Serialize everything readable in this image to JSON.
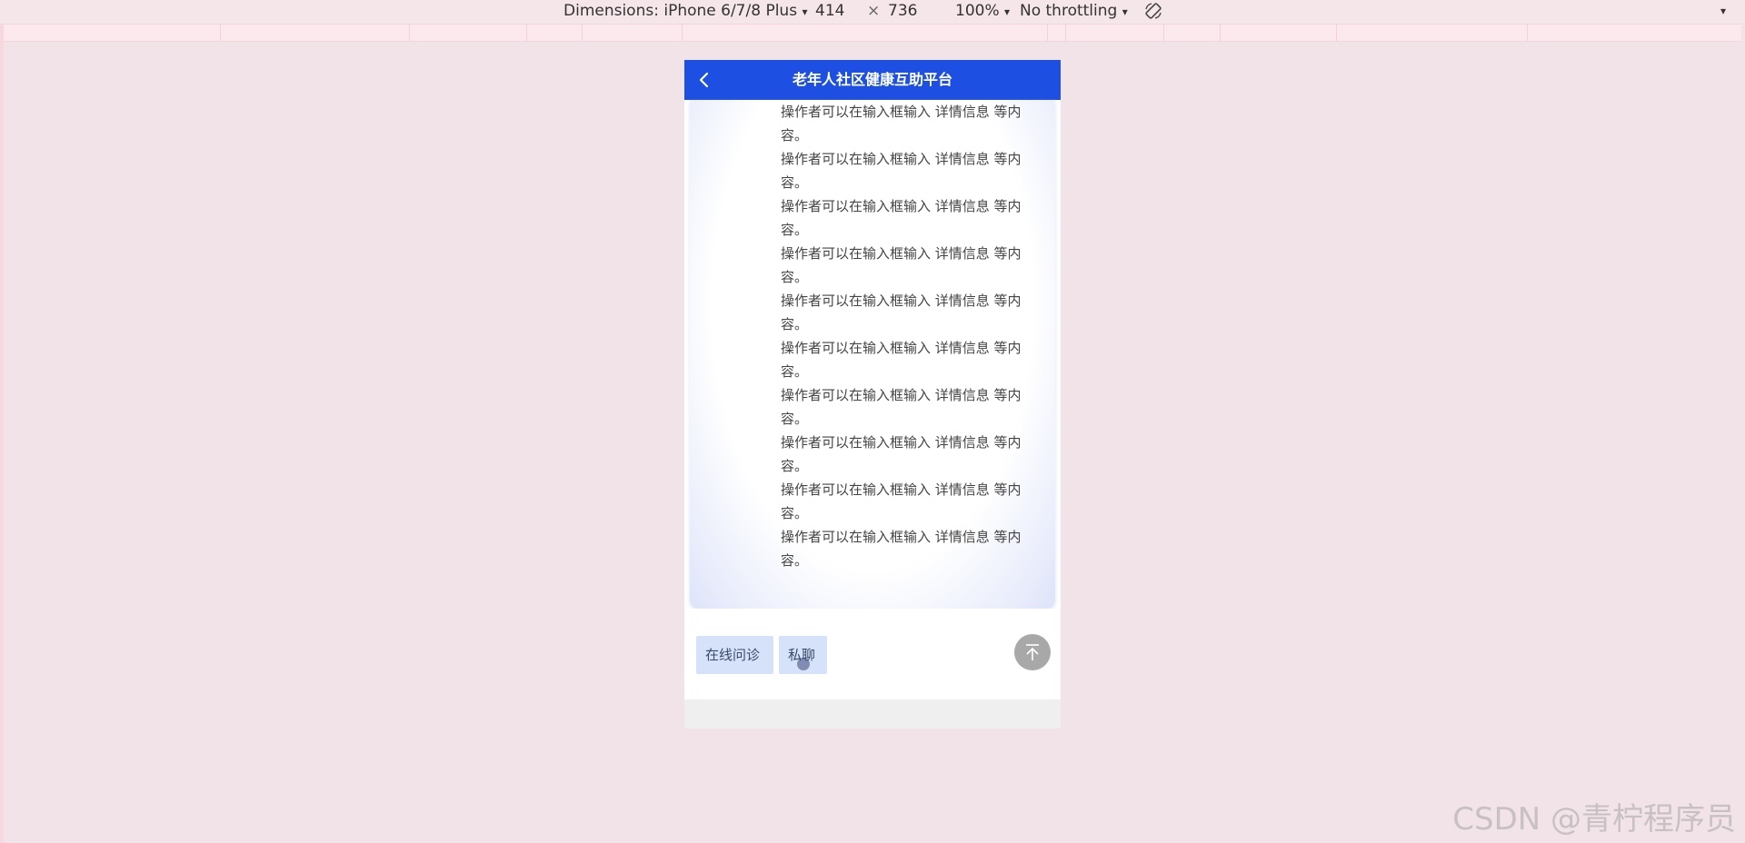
{
  "devtools": {
    "dimensions_label": "Dimensions: iPhone 6/7/8 Plus",
    "width": "414",
    "times": "×",
    "height": "736",
    "zoom": "100%",
    "throttling": "No throttling",
    "dropdown_glyph": "▾"
  },
  "app": {
    "title": "老年人社区健康互助平台",
    "content_lines": [
      "操作者可以在输入框输入 详情信息 等内容。",
      "操作者可以在输入框输入 详情信息 等内容。",
      "操作者可以在输入框输入 详情信息 等内容。",
      "操作者可以在输入框输入 详情信息 等内容。",
      "操作者可以在输入框输入 详情信息 等内容。",
      "操作者可以在输入框输入 详情信息 等内容。",
      "操作者可以在输入框输入 详情信息 等内容。",
      "操作者可以在输入框输入 详情信息 等内容。",
      "操作者可以在输入框输入 详情信息 等内容。",
      "操作者可以在输入框输入 详情信息 等内容。"
    ],
    "buttons": {
      "online_consult": "在线问诊",
      "chat": "私聊"
    }
  },
  "watermark": "CSDN @青柠程序员"
}
